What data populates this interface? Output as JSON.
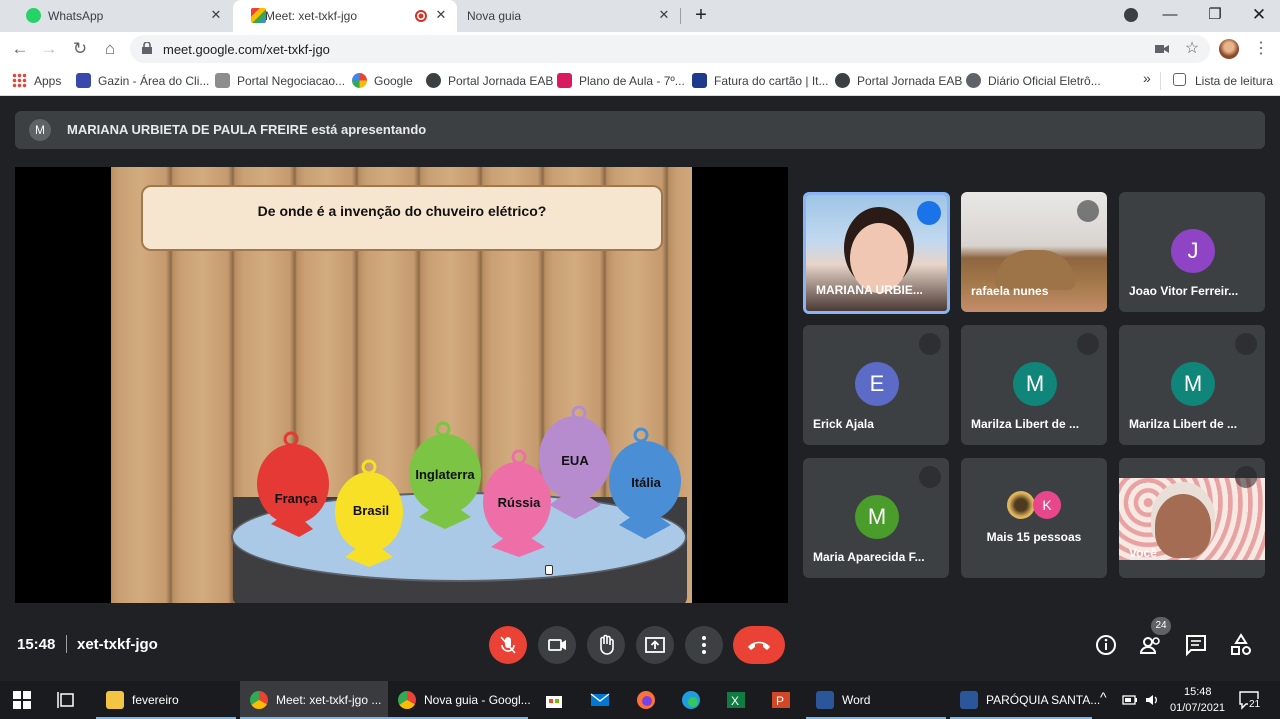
{
  "browser": {
    "tabs": [
      {
        "label": "WhatsApp",
        "active": false
      },
      {
        "label": "Meet: xet-txkf-jgo",
        "active": true
      },
      {
        "label": "Nova guia",
        "active": false
      }
    ],
    "url": "meet.google.com/xet-txkf-jgo",
    "bookmarks": [
      "Apps",
      "Gazin - Área do Cli...",
      "Portal Negociacao...",
      "Google",
      "Portal Jornada EAB",
      "Plano de Aula - 7º...",
      "Fatura do cartão | It...",
      "Portal Jornada EAB",
      "Diário Oficial Eletrô..."
    ],
    "reading_list": "Lista de leitura"
  },
  "meet": {
    "presenter_initial": "M",
    "presenter_text": "MARIANA URBIETA DE PAULA FREIRE está apresentando",
    "slide": {
      "question": "De onde é a invenção do chuveiro elétrico?",
      "fish": [
        {
          "label": "França",
          "color": "#e53935"
        },
        {
          "label": "Brasil",
          "color": "#f7e026"
        },
        {
          "label": "Inglaterra",
          "color": "#7cc443"
        },
        {
          "label": "Rússia",
          "color": "#ee6fa8"
        },
        {
          "label": "EUA",
          "color": "#b78ccf"
        },
        {
          "label": "Itália",
          "color": "#4a8fd6"
        }
      ]
    },
    "participants": [
      {
        "name": "MARIANA URBIE...",
        "initial": "",
        "avatar_color": "",
        "video": true,
        "speaking": true
      },
      {
        "name": "rafaela nunes",
        "initial": "",
        "avatar_color": "",
        "video": true,
        "muted": true
      },
      {
        "name": "Joao Vitor Ferreir...",
        "initial": "J",
        "avatar_color": "#8e44c4"
      },
      {
        "name": "Erick Ajala",
        "initial": "E",
        "avatar_color": "#5b6bc6",
        "muted": true
      },
      {
        "name": "Marilza Libert de ...",
        "initial": "M",
        "avatar_color": "#10857a",
        "muted": true
      },
      {
        "name": "Marilza Libert de ...",
        "initial": "M",
        "avatar_color": "#10857a",
        "muted": true
      },
      {
        "name": "Maria Aparecida F...",
        "initial": "M",
        "avatar_color": "#4a9c2b",
        "muted": true
      },
      {
        "name": "Mais 15 pessoas",
        "initial": "K",
        "avatar_color": "#e8478b"
      },
      {
        "name": "Você",
        "initial": "",
        "avatar_color": "",
        "video": true,
        "muted": true
      }
    ],
    "time": "15:48",
    "meeting_code": "xet-txkf-jgo",
    "participants_count": "24"
  },
  "taskbar": {
    "items": [
      "fevereiro",
      "Meet: xet-txkf-jgo ...",
      "Nova guia - Googl...",
      "Word",
      "PARÓQUIA SANTA..."
    ],
    "time": "15:48",
    "date": "01/07/2021",
    "notifications": "21"
  }
}
